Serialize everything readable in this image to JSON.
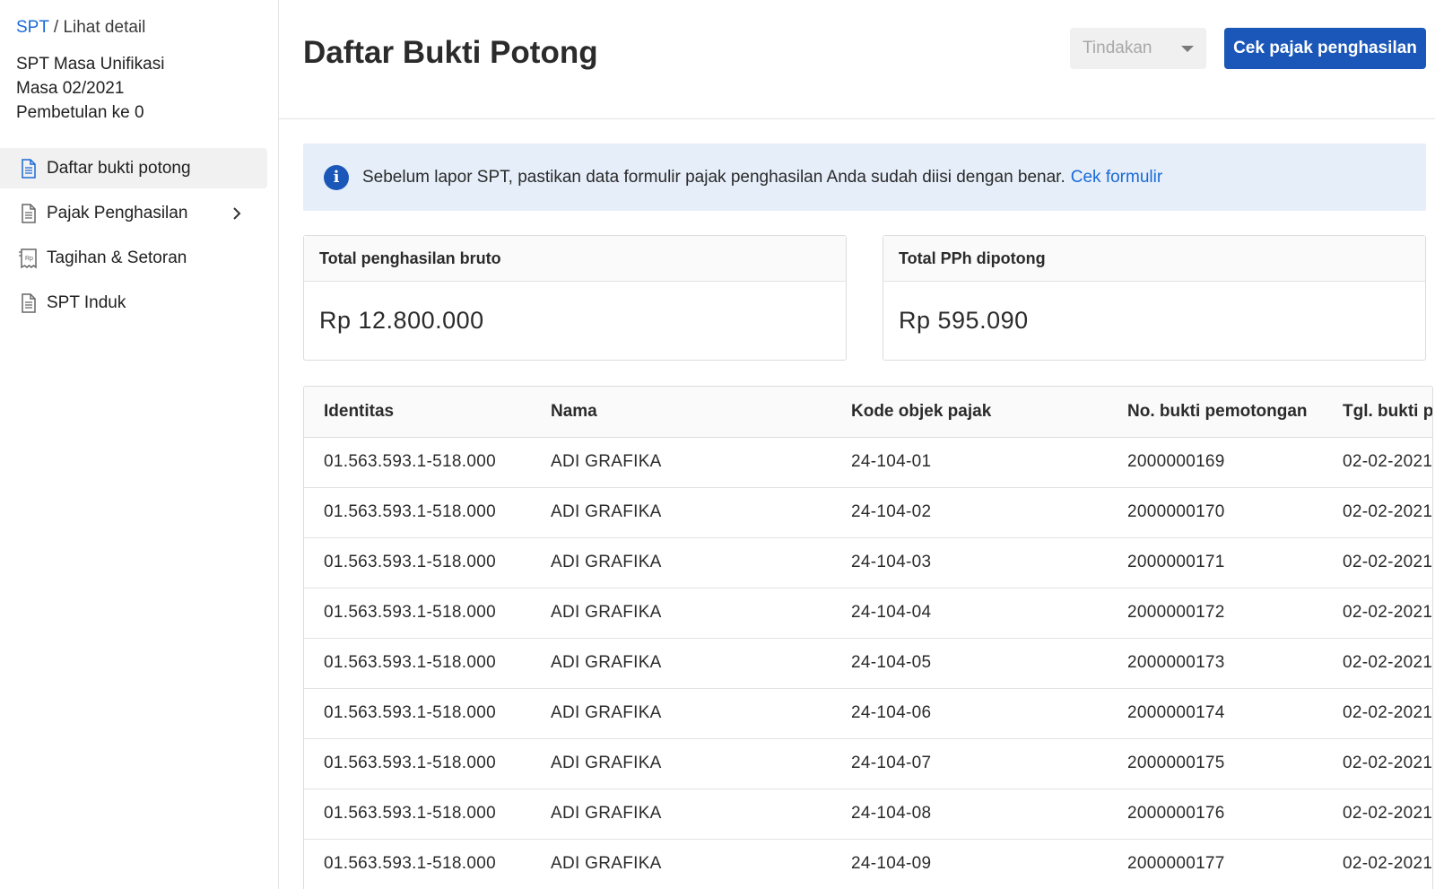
{
  "sidebar": {
    "breadcrumb": {
      "root": "SPT",
      "separator": " / ",
      "current": "Lihat detail"
    },
    "info": {
      "line1": "SPT Masa Unifikasi",
      "line2": "Masa 02/2021",
      "line3": "Pembetulan ke 0"
    },
    "items": [
      {
        "label": "Daftar bukti potong",
        "icon": "document-icon",
        "active": true
      },
      {
        "label": "Pajak Penghasilan",
        "icon": "document-icon",
        "has_children": true
      },
      {
        "label": "Tagihan & Setoran",
        "icon": "receipt-icon"
      },
      {
        "label": "SPT Induk",
        "icon": "document-icon"
      }
    ]
  },
  "header": {
    "title": "Daftar Bukti Potong",
    "actions_placeholder": "Tindakan",
    "primary_button": "Cek pajak penghasilan"
  },
  "banner": {
    "text": "Sebelum lapor SPT, pastikan data formulir pajak penghasilan Anda sudah diisi dengan benar.",
    "link": "Cek formulir"
  },
  "summary": {
    "bruto": {
      "label": "Total penghasilan bruto",
      "value": "Rp 12.800.000"
    },
    "pph": {
      "label": "Total PPh dipotong",
      "value": "Rp 595.090"
    }
  },
  "table": {
    "columns": [
      "Identitas",
      "Nama",
      "Kode objek pajak",
      "No. bukti pemotongan",
      "Tgl. bukti potong"
    ],
    "rows": [
      [
        "01.563.593.1-518.000",
        "ADI GRAFIKA",
        "24-104-01",
        "2000000169",
        "02-02-2021"
      ],
      [
        "01.563.593.1-518.000",
        "ADI GRAFIKA",
        "24-104-02",
        "2000000170",
        "02-02-2021"
      ],
      [
        "01.563.593.1-518.000",
        "ADI GRAFIKA",
        "24-104-03",
        "2000000171",
        "02-02-2021"
      ],
      [
        "01.563.593.1-518.000",
        "ADI GRAFIKA",
        "24-104-04",
        "2000000172",
        "02-02-2021"
      ],
      [
        "01.563.593.1-518.000",
        "ADI GRAFIKA",
        "24-104-05",
        "2000000173",
        "02-02-2021"
      ],
      [
        "01.563.593.1-518.000",
        "ADI GRAFIKA",
        "24-104-06",
        "2000000174",
        "02-02-2021"
      ],
      [
        "01.563.593.1-518.000",
        "ADI GRAFIKA",
        "24-104-07",
        "2000000175",
        "02-02-2021"
      ],
      [
        "01.563.593.1-518.000",
        "ADI GRAFIKA",
        "24-104-08",
        "2000000176",
        "02-02-2021"
      ],
      [
        "01.563.593.1-518.000",
        "ADI GRAFIKA",
        "24-104-09",
        "2000000177",
        "02-02-2021"
      ]
    ]
  },
  "colors": {
    "primary": "#1a57b8",
    "link": "#1a6ad6",
    "banner_bg": "#e5eef9"
  }
}
